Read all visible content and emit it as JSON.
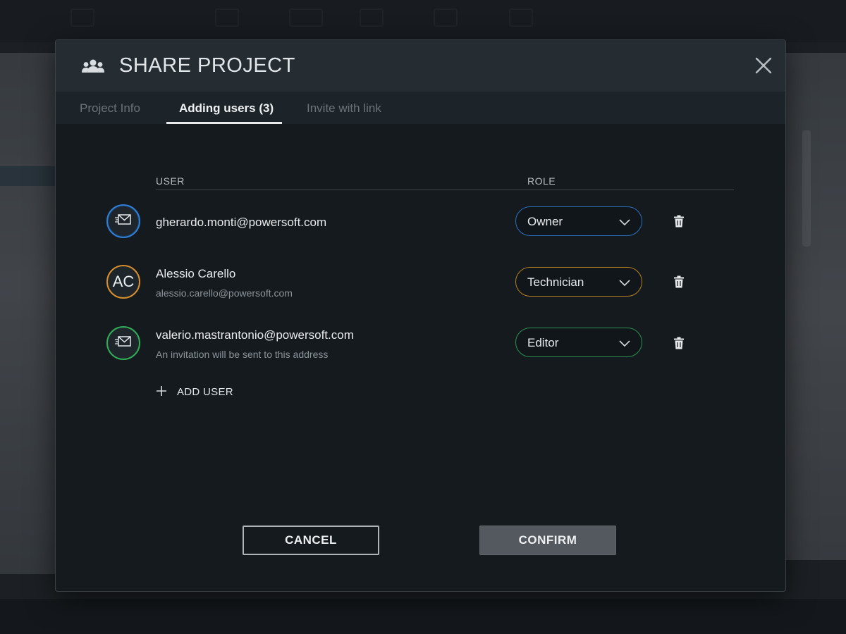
{
  "dialog": {
    "title": "SHARE PROJECT",
    "title_icon": "users-icon",
    "close_icon": "close-icon"
  },
  "tabs": [
    {
      "label": "Project Info",
      "active": false
    },
    {
      "label": "Adding users (3)",
      "active": true
    },
    {
      "label": "Invite with link",
      "active": false
    }
  ],
  "table": {
    "headers": {
      "user": "USER",
      "role": "ROLE"
    },
    "rows": [
      {
        "avatar_type": "envelope-icon",
        "avatar_color": "#2f7fd6",
        "name": "gherardo.monti@powersoft.com",
        "subtext": "",
        "role": "Owner",
        "role_color": "#2a6fbd"
      },
      {
        "avatar_type": "initials",
        "initials": "AC",
        "avatar_color": "#d88e2c",
        "name": "Alessio Carello",
        "subtext": "alessio.carello@powersoft.com",
        "role": "Technician",
        "role_color": "#b7801f"
      },
      {
        "avatar_type": "envelope-icon",
        "avatar_color": "#2fae57",
        "name": "valerio.mastrantonio@powersoft.com",
        "subtext": "An invitation will be sent to this address",
        "role": "Editor",
        "role_color": "#2b9150"
      }
    ]
  },
  "add_user": {
    "label": "ADD USER",
    "icon": "plus-icon"
  },
  "buttons": {
    "cancel": "CANCEL",
    "confirm": "CONFIRM"
  },
  "colors": {
    "dialog_bg": "#151a1e",
    "header_bg": "#252d33",
    "tabs_bg": "#1d2429",
    "confirm_bg": "#53595e"
  }
}
